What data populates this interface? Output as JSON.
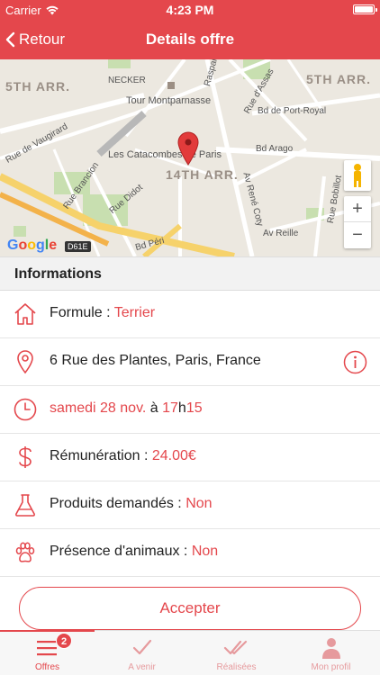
{
  "status_bar": {
    "carrier": "Carrier",
    "time": "4:23 PM",
    "wifi_icon": "wifi-icon",
    "battery_level": 1.0
  },
  "nav": {
    "back_label": "Retour",
    "title": "Details offre"
  },
  "map": {
    "labels": {
      "arr5_left": "5TH ARR.",
      "arr5_right": "5TH ARR.",
      "arr14": "14TH ARR.",
      "necker": "NECKER",
      "montparnasse": "Tour Montparnasse",
      "catacombes": "Les Catacombes de Paris",
      "vaugirard": "Rue de Vaugirard",
      "brancion": "Rue Brancion",
      "didot": "Rue Didot",
      "port_royal": "Bd de Port-Royal",
      "arago": "Bd Arago",
      "assas": "Rue d'Assas",
      "raspail": "Raspail",
      "coty": "Av René Coty",
      "reille": "Av Reille",
      "bobillot": "Rue Bobillot",
      "bd_peri": "Bd Péri",
      "d61e": "D61E",
      "google": "Google"
    },
    "pin_icon": "map-pin-icon",
    "pegman_icon": "pegman-icon",
    "zoom_in": "+",
    "zoom_out": "−"
  },
  "section": {
    "title": "Informations"
  },
  "details": {
    "formule_label": "Formule : ",
    "formule_value": "Terrier",
    "address": "6 Rue des Plantes, Paris, France",
    "date": "samedi 28 nov.",
    "date_sep": " à ",
    "hour": "17",
    "hour_sep": "h",
    "minute": "15",
    "remuneration_label": "Rémunération : ",
    "remuneration_value": "24.00€",
    "produits_label": "Produits demandés : ",
    "produits_value": "Non",
    "animaux_label": "Présence d'animaux : ",
    "animaux_value": "Non"
  },
  "actions": {
    "accept_label": "Accepter"
  },
  "tabs": [
    {
      "label": "Offres",
      "icon": "menu-list-icon",
      "badge": "2"
    },
    {
      "label": "A venir",
      "icon": "check-icon"
    },
    {
      "label": "Réalisées",
      "icon": "double-check-icon"
    },
    {
      "label": "Mon profil",
      "icon": "person-icon"
    }
  ],
  "colors": {
    "accent": "#e4474c",
    "tab_inactive": "#e69a9d",
    "section_bg": "#f2f2f2"
  }
}
